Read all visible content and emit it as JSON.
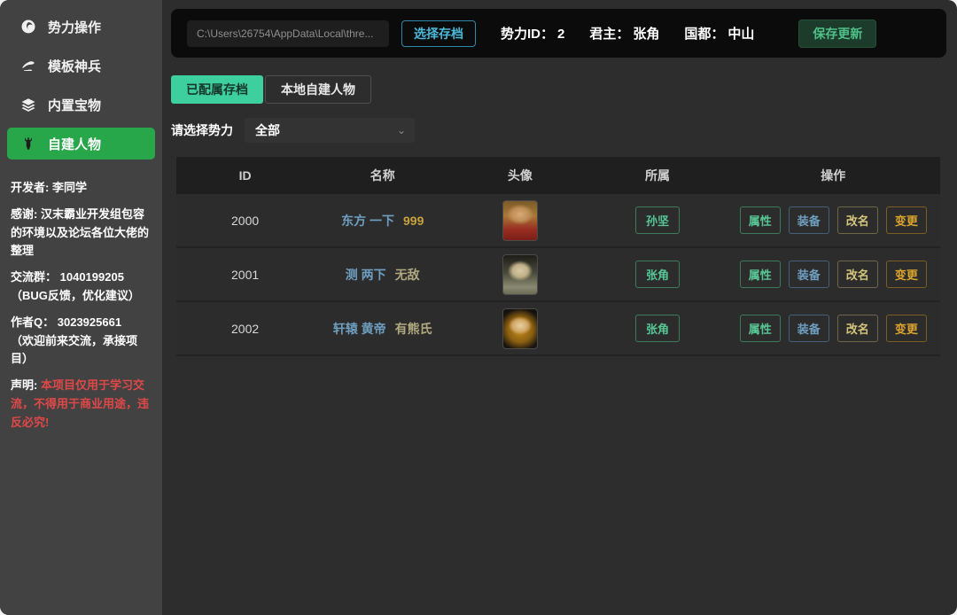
{
  "colors": {
    "sidebar_bg": "#424242",
    "main_bg": "#2d2d2d",
    "topbar_bg": "#0b0b0b",
    "accent_green": "#27a74a",
    "tab_active_green": "#3ecf9f",
    "cyan_accent": "#4ab8d8",
    "save_button_green": "#4fc088",
    "name_blue": "#6f9fc0",
    "gold": "#c9a23e",
    "khaki": "#b0a87e",
    "tag_green": "#55c795",
    "danger_red": "#e04848"
  },
  "sidebar": {
    "menu": [
      {
        "label": "势力操作",
        "icon": "faction-ops-icon",
        "active": false
      },
      {
        "label": "模板神兵",
        "icon": "template-weapon-icon",
        "active": false
      },
      {
        "label": "内置宝物",
        "icon": "builtin-treasure-icon",
        "active": false
      },
      {
        "label": "自建人物",
        "icon": "custom-character-icon",
        "active": true
      }
    ],
    "info": {
      "developer_label": "开发者:",
      "developer": "李同学",
      "thanks_label": "感谢:",
      "thanks": "汉末霸业开发组包容的环境以及论坛各位大佬的整理",
      "qq_label": "交流群：",
      "qq": "1040199205",
      "qq_note": "（BUG反馈，优化建议）",
      "author_label": "作者Q：",
      "author": "3023925661",
      "author_note": "（欢迎前来交流，承接项目）",
      "disclaimer_label": "声明:",
      "disclaimer": "本项目仅用于学习交流，不得用于商业用途，违反必究!"
    }
  },
  "topbar": {
    "path_value": "C:\\Users\\26754\\AppData\\Local\\thre...",
    "choose_save_label": "选择存档",
    "faction_id_label": "势力ID：",
    "faction_id": "2",
    "lord_label": "君主：",
    "lord": "张角",
    "capital_label": "国都：",
    "capital": "中山",
    "save_update_label": "保存更新"
  },
  "tabs": [
    {
      "label": "已配属存档",
      "active": true
    },
    {
      "label": "本地自建人物",
      "active": false
    }
  ],
  "filter": {
    "label": "请选择势力",
    "selected": "全部",
    "chevron_icon": "chevron-down-icon"
  },
  "table": {
    "columns": [
      "ID",
      "名称",
      "头像",
      "所属",
      "操作"
    ],
    "action_labels": [
      "属性",
      "装备",
      "改名",
      "变更"
    ],
    "rows": [
      {
        "id": "2000",
        "name_main": "东方 一下",
        "name_suffix": "999",
        "faction": "孙坚",
        "avatar": "warrior-red-gold-portrait"
      },
      {
        "id": "2001",
        "name_main": "测 两下",
        "name_suffix": "无敌",
        "faction": "张角",
        "avatar": "pale-scholar-portrait"
      },
      {
        "id": "2002",
        "name_main": "轩辕 黄帝",
        "name_suffix": "有熊氏",
        "faction": "张角",
        "avatar": "dark-hair-golden-glow-portrait"
      }
    ]
  }
}
